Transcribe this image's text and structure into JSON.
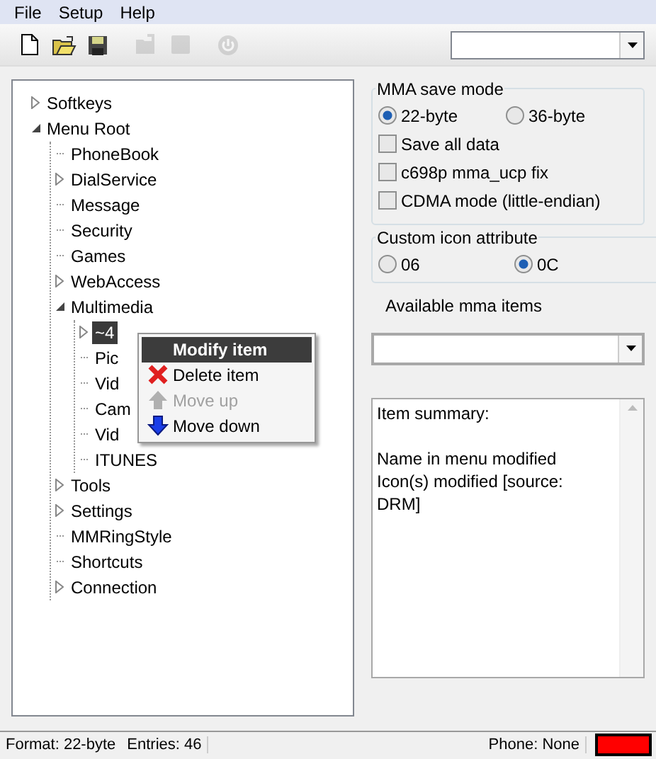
{
  "menubar": [
    "File",
    "Setup",
    "Help"
  ],
  "toolbar": [
    {
      "kind": "new",
      "disabled": false
    },
    {
      "kind": "open",
      "disabled": false
    },
    {
      "kind": "save",
      "disabled": false
    },
    {
      "kind": "import",
      "disabled": true
    },
    {
      "kind": "square",
      "disabled": true
    },
    {
      "kind": "power",
      "disabled": true
    }
  ],
  "tree": [
    {
      "label": "Softkeys",
      "kind": "collapsed"
    },
    {
      "label": "Menu Root",
      "kind": "expanded",
      "children": [
        {
          "label": "PhoneBook",
          "kind": "leaf"
        },
        {
          "label": "DialService",
          "kind": "collapsed"
        },
        {
          "label": "Message",
          "kind": "leaf"
        },
        {
          "label": "Security",
          "kind": "leaf"
        },
        {
          "label": "Games",
          "kind": "leaf"
        },
        {
          "label": "WebAccess",
          "kind": "collapsed"
        },
        {
          "label": "Multimedia",
          "kind": "expanded",
          "children": [
            {
              "label": "~4",
              "kind": "collapsed",
              "selected": true
            },
            {
              "label": "Pic",
              "kind": "leaf",
              "selected": false
            },
            {
              "label": "Vid",
              "kind": "leaf",
              "selected": false
            },
            {
              "label": "Cam",
              "kind": "leaf",
              "selected": false
            },
            {
              "label": "Vid",
              "kind": "leaf",
              "selected": false
            },
            {
              "label": "ITUNES",
              "kind": "leaf",
              "selected": false
            }
          ]
        },
        {
          "label": "Tools",
          "kind": "collapsed"
        },
        {
          "label": "Settings",
          "kind": "collapsed"
        },
        {
          "label": "MMRingStyle",
          "kind": "leaf"
        },
        {
          "label": "Shortcuts",
          "kind": "leaf"
        },
        {
          "label": "Connection",
          "kind": "collapsed"
        }
      ]
    }
  ],
  "context_menu": [
    {
      "label": "Modify item",
      "kind": "plain",
      "selected": true,
      "disabled": false
    },
    {
      "label": "Delete item",
      "kind": "delete",
      "selected": false,
      "disabled": false
    },
    {
      "label": "Move up",
      "kind": "up",
      "selected": false,
      "disabled": true
    },
    {
      "label": "Move down",
      "kind": "down",
      "selected": false,
      "disabled": false
    }
  ],
  "mma_save_mode": {
    "title": "MMA save mode",
    "radios": [
      {
        "label": "22-byte",
        "selected": true
      },
      {
        "label": "36-byte",
        "selected": false
      }
    ],
    "checkboxes": [
      {
        "label": "Save all data",
        "checked": false
      },
      {
        "label": "c698p mma_ucp fix",
        "checked": false
      },
      {
        "label": "CDMA mode (little-endian)",
        "checked": false
      }
    ]
  },
  "custom_icon_attribute": {
    "title": "Custom icon attribute",
    "radios": [
      {
        "label": "06",
        "selected": false
      },
      {
        "label": "0C",
        "selected": true
      }
    ]
  },
  "available_label": "Available mma items",
  "summary": [
    "Item summary:",
    "Name in menu modified",
    "Icon(s) modified [source: DRM]"
  ],
  "status_bar": {
    "format": "Format: 22-byte",
    "entries": "Entries: 46",
    "phone": "Phone: None"
  }
}
